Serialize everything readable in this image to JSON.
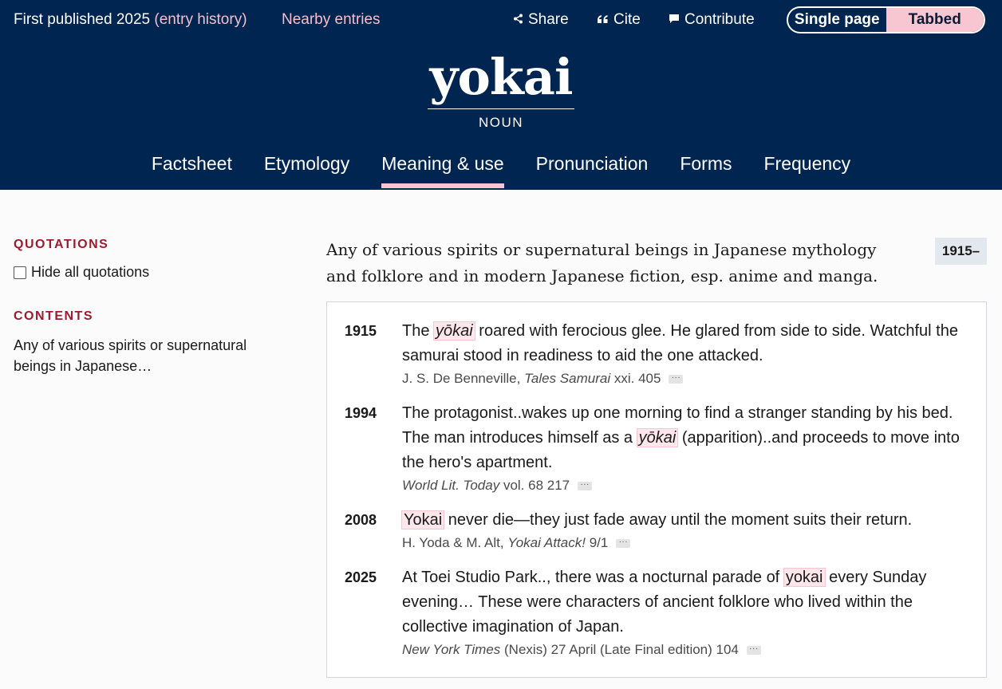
{
  "topbar": {
    "published": "First published 2025",
    "entry_history": "(entry history)",
    "nearby": "Nearby entries",
    "share": "Share",
    "cite": "Cite",
    "contribute": "Contribute",
    "toggle_single": "Single page",
    "toggle_tabbed": "Tabbed"
  },
  "headword": "yokai",
  "part_of_speech": "NOUN",
  "tabs": [
    "Factsheet",
    "Etymology",
    "Meaning & use",
    "Pronunciation",
    "Forms",
    "Frequency"
  ],
  "active_tab": "Meaning & use",
  "sidebar": {
    "quotations_heading": "QUOTATIONS",
    "hide_all": "Hide all quotations",
    "contents_heading": "CONTENTS",
    "contents_text": "Any of various spirits or supernatural beings in Japanese…"
  },
  "definition": {
    "text": "Any of various spirits or supernatural beings in Japanese mythology and folklore and in modern Japanese fiction, esp. anime and manga.",
    "date_range": "1915–"
  },
  "quotations": [
    {
      "year": "1915",
      "pre": "The ",
      "hl": "yōkai",
      "post": " roared with ferocious glee. He glared from side to side. Watchful the samurai stood in readiness to aid the one attacked.",
      "source_a": "J. S. De Benneville, ",
      "source_i": "Tales Samurai",
      "source_b": " xxi. 405"
    },
    {
      "year": "1994",
      "pre": "The protagonist..wakes up one morning to find a stranger standing by his bed. The man introduces himself as a ",
      "hl": "yōkai",
      "post": " (apparition)..and proceeds to move into the hero's apartment.",
      "source_a": "",
      "source_i": "World Lit. Today",
      "source_b": " vol. 68 217"
    },
    {
      "year": "2008",
      "pre": "",
      "hl": "Yokai",
      "post": " never die—they just fade away until the moment suits their return.",
      "source_a": "H. Yoda & M. Alt, ",
      "source_i": "Yokai Attack!",
      "source_b": " 9/1"
    },
    {
      "year": "2025",
      "pre": "At Toei Studio Park.., there was a nocturnal parade of ",
      "hl": "yokai",
      "post": " every Sunday evening… These were characters of ancient folklore who lived within the collective imagination of Japan.",
      "source_a": "",
      "source_i": "New York Times",
      "source_b": " (Nexis) 27 April (Late Final edition) 104"
    }
  ]
}
